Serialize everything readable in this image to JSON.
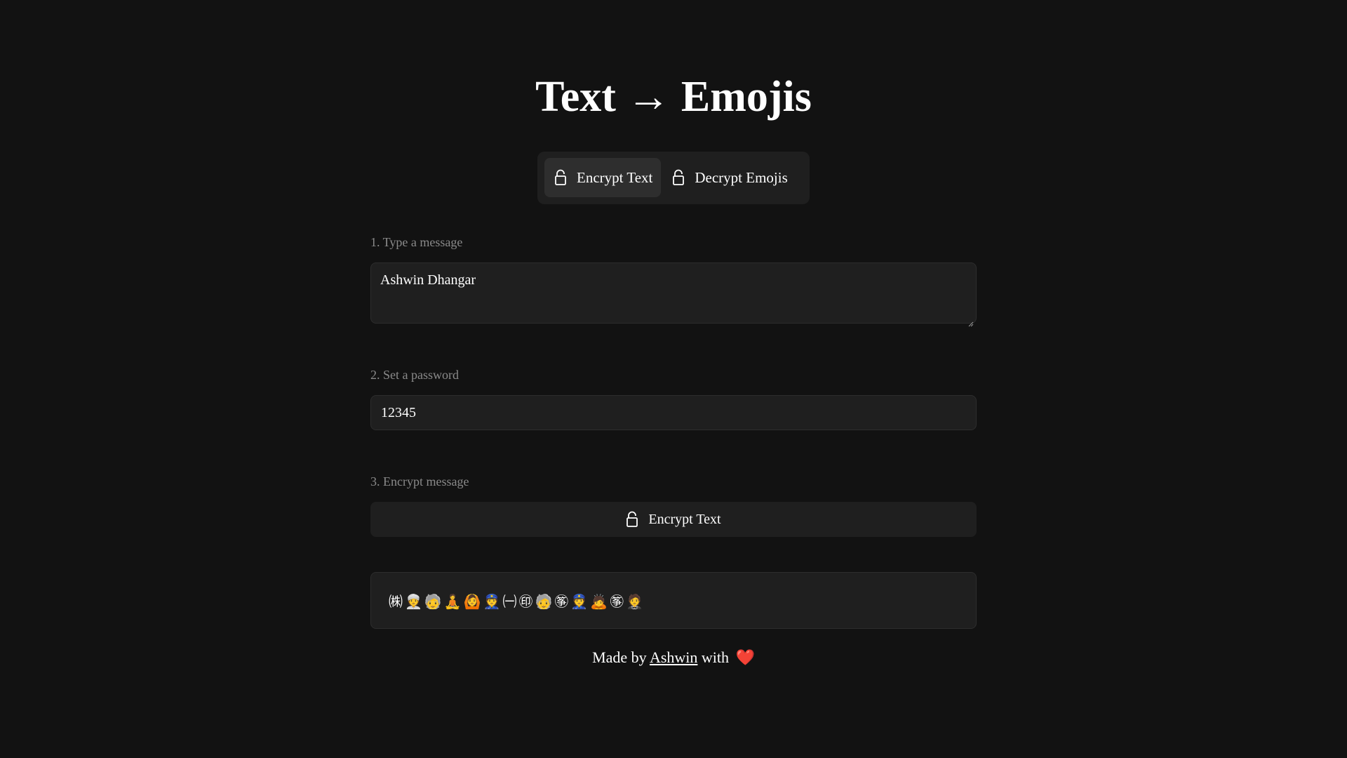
{
  "header": {
    "title": "Text → Emojis"
  },
  "tabs": [
    {
      "label": "Encrypt Text",
      "icon": "lock-icon",
      "active": true
    },
    {
      "label": "Decrypt Emojis",
      "icon": "lock-icon",
      "active": false
    }
  ],
  "form": {
    "message_label": "1. Type a message",
    "message_value": "Ashwin Dhangar",
    "password_label": "2. Set a password",
    "password_value": "12345",
    "encrypt_label": "3. Encrypt message",
    "encrypt_button": "Encrypt Text"
  },
  "output": {
    "emojis": "㈱👳🧓🧘🙆👮㈠㊞🧓㉇👮🙇㉇🤵"
  },
  "footer": {
    "prefix": "Made by",
    "author": "Ashwin",
    "suffix": "with",
    "heart": "❤️"
  },
  "colors": {
    "background": "#121212",
    "panel": "#1f1f1f",
    "active_tab": "#2e2e2e",
    "label": "#8a8a8a",
    "heart": "#e0262c"
  }
}
